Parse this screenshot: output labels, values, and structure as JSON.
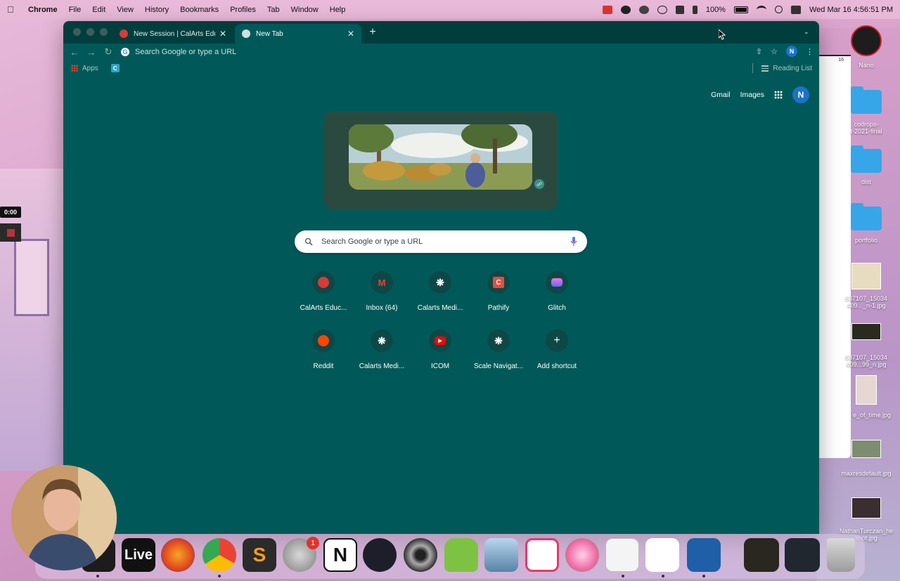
{
  "menubar": {
    "app": "Chrome",
    "items": [
      "File",
      "Edit",
      "View",
      "History",
      "Bookmarks",
      "Profiles",
      "Tab",
      "Window",
      "Help"
    ],
    "battery": "100%",
    "clock": "Wed Mar 16  4:56:51 PM"
  },
  "recorder": {
    "timer": "0:00"
  },
  "browser": {
    "tabs": [
      {
        "title": "New Session | CalArts Educatio",
        "active": false
      },
      {
        "title": "New Tab",
        "active": true
      }
    ],
    "omnibox_text": "Search Google or type a URL",
    "profile_initial": "N",
    "bookmarks": {
      "apps": "Apps",
      "c_icon": "C",
      "reading_list": "Reading List"
    }
  },
  "page": {
    "top_links": {
      "gmail": "Gmail",
      "images": "Images",
      "profile_initial": "N"
    },
    "search_placeholder": "Search Google or type a URL",
    "shortcuts": [
      {
        "label": "CalArts Educ...",
        "icon": "calarts-icon",
        "color": "#d93a3a"
      },
      {
        "label": "Inbox (64)",
        "icon": "gmail-icon",
        "color": "#ea4335"
      },
      {
        "label": "Calarts Medi...",
        "icon": "calarts-media-icon",
        "color": "#ffffff"
      },
      {
        "label": "Pathify",
        "icon": "pathify-icon",
        "color": "#e74c3c"
      },
      {
        "label": "Glitch",
        "icon": "glitch-icon",
        "color": "#ff6fd8"
      },
      {
        "label": "Reddit",
        "icon": "reddit-icon",
        "color": "#ff4500"
      },
      {
        "label": "Calarts Medi...",
        "icon": "calarts-media-icon",
        "color": "#ffffff"
      },
      {
        "label": "ICOM",
        "icon": "youtube-icon",
        "color": "#ff0000"
      },
      {
        "label": "Scale Navigat...",
        "icon": "scale-icon",
        "color": "#ffffff"
      },
      {
        "label": "Add shortcut",
        "icon": "plus-icon",
        "color": "#ffffff"
      }
    ],
    "pathify_letter": "C"
  },
  "desktop": {
    "nano": "Nano",
    "folders": [
      "codrops-\nt-2021-final",
      "dist",
      "portfolio"
    ],
    "files": [
      "637107_15034\n409..._n-1.jpg",
      "637107_15034\n409...99_n.jpg",
      "e_of_time.jpg",
      "maxresdefault.jpg",
      "NathanTurczan_he\nsnot.jpg"
    ],
    "corner_number": "16"
  },
  "dock": {
    "live_label": "Live",
    "badge": "1"
  },
  "colors": {
    "ntp_background": "#005958",
    "tabstrip": "#003e3d",
    "accent_blue": "#1a73c8"
  }
}
